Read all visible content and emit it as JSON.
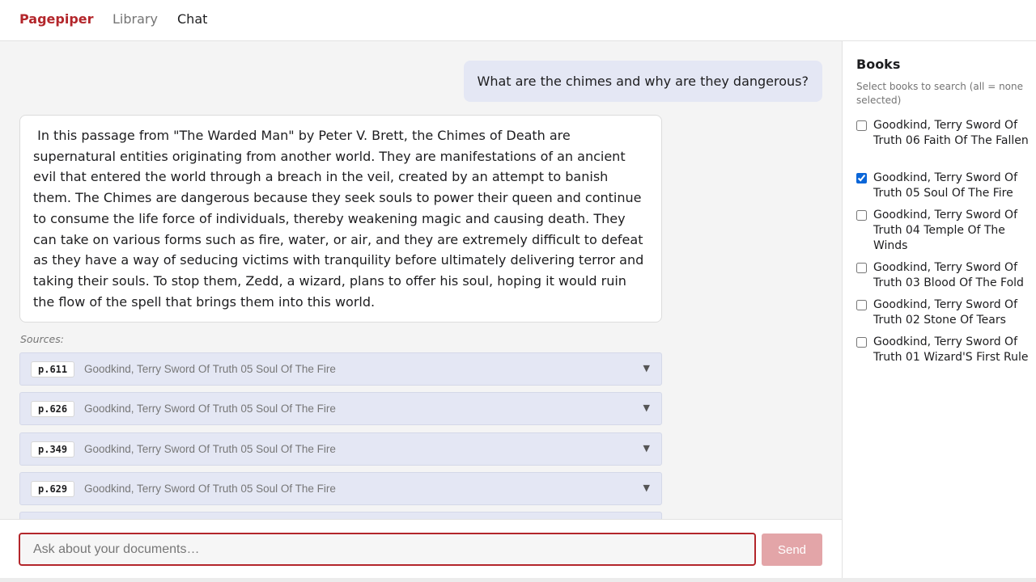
{
  "nav": {
    "brand": "Pagepiper",
    "links": [
      "Library",
      "Chat"
    ]
  },
  "colors": {
    "brand": "#b3262b",
    "bubble": "#e4e7f4",
    "send_disabled": "#e3a5a8",
    "checkbox_accent": "#0b66d8"
  },
  "chat": {
    "question": "What are the chimes and why are they dangerous?",
    "answer": " In this passage from \"The Warded Man\" by Peter V. Brett, the Chimes of Death are supernatural entities originating from another world. They are manifestations of an ancient evil that entered the world through a breach in the veil, created by an attempt to banish them. The Chimes are dangerous because they seek souls to power their queen and continue to consume the life force of individuals, thereby weakening magic and causing death. They can take on various forms such as fire, water, or air, and they are extremely difficult to defeat as they have a way of seducing victims with tranquility before ultimately delivering terror and taking their souls. To stop them, Zedd, a wizard, plans to offer his soul, hoping it would ruin the flow of the spell that brings them into this world.",
    "sources_label": "Sources:",
    "sources": [
      {
        "page": "p.611",
        "title": "Goodkind, Terry Sword Of Truth 05 Soul Of The Fire",
        "icon": "chevron-down-icon"
      },
      {
        "page": "p.626",
        "title": "Goodkind, Terry Sword Of Truth 05 Soul Of The Fire",
        "icon": "chevron-down-icon"
      },
      {
        "page": "p.349",
        "title": "Goodkind, Terry Sword Of Truth 05 Soul Of The Fire",
        "icon": "chevron-down-icon"
      },
      {
        "page": "p.629",
        "title": "Goodkind, Terry Sword Of Truth 05 Soul Of The Fire",
        "icon": "chevron-down-icon"
      }
    ]
  },
  "input": {
    "placeholder": "Ask about your documents…",
    "value": "",
    "send_label": "Send"
  },
  "sidebar": {
    "title": "Books",
    "hint": "Select books to search (all = none selected)",
    "books": [
      {
        "label": "Goodkind, Terry Sword Of Truth 06 Faith Of The Fallen",
        "checked": false
      },
      {
        "label": "Goodkind, Terry Sword Of Truth 05 Soul Of The Fire",
        "checked": true
      },
      {
        "label": "Goodkind, Terry Sword Of Truth 04 Temple Of The Winds",
        "checked": false
      },
      {
        "label": "Goodkind, Terry Sword Of Truth 03 Blood Of The Fold",
        "checked": false
      },
      {
        "label": "Goodkind, Terry Sword Of Truth 02 Stone Of Tears",
        "checked": false
      },
      {
        "label": "Goodkind, Terry Sword Of Truth 01 Wizard'S First Rule",
        "checked": false
      }
    ]
  }
}
